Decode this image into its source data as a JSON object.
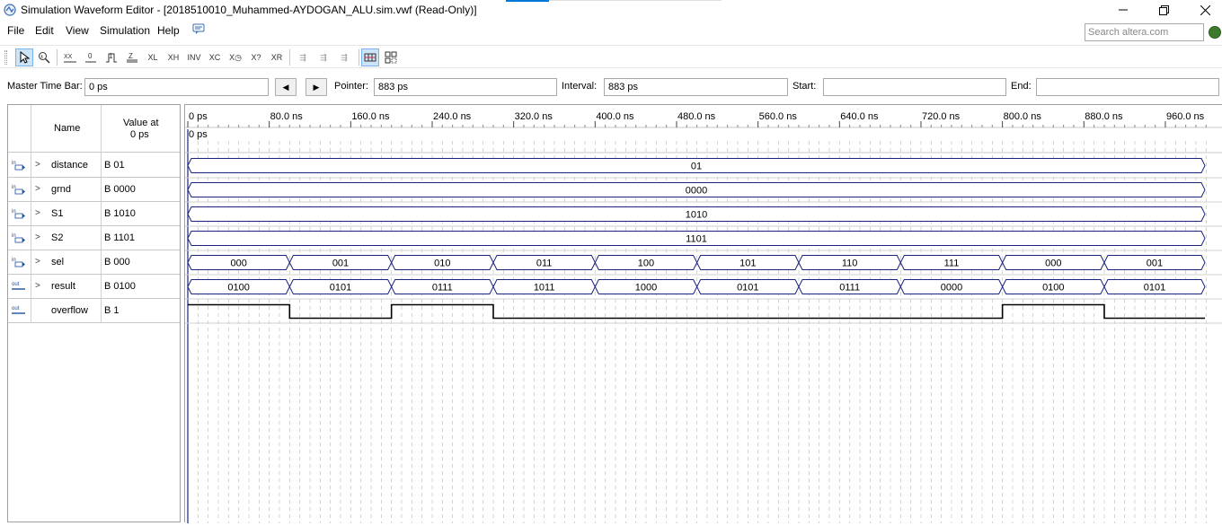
{
  "window": {
    "title": "Simulation Waveform Editor - [2018510010_Muhammed-AYDOGAN_ALU.sim.vwf (Read-Only)]"
  },
  "menu": [
    "File",
    "Edit",
    "View",
    "Simulation",
    "Help"
  ],
  "search": {
    "placeholder": "Search altera.com"
  },
  "timebar": {
    "master_label": "Master Time Bar:",
    "master_value": "0 ps",
    "pointer_label": "Pointer:",
    "pointer_value": "883 ps",
    "interval_label": "Interval:",
    "interval_value": "883 ps",
    "start_label": "Start:",
    "start_value": "",
    "end_label": "End:",
    "end_value": ""
  },
  "columns": {
    "name": "Name",
    "value_line1": "Value at",
    "value_line2": "0 ps"
  },
  "signals": [
    {
      "name": "distance",
      "value": "B 01",
      "dir": "in",
      "bus": true
    },
    {
      "name": "grnd",
      "value": "B 0000",
      "dir": "in",
      "bus": true
    },
    {
      "name": "S1",
      "value": "B 1010",
      "dir": "in",
      "bus": true
    },
    {
      "name": "S2",
      "value": "B 1101",
      "dir": "in",
      "bus": true
    },
    {
      "name": "sel",
      "value": "B 000",
      "dir": "in",
      "bus": true
    },
    {
      "name": "result",
      "value": "B 0100",
      "dir": "out",
      "bus": true
    },
    {
      "name": "overflow",
      "value": "B 1",
      "dir": "out",
      "bus": false
    }
  ],
  "time_axis": {
    "tick_labels": [
      "0 ps",
      "80.0 ns",
      "160.0 ns",
      "240.0 ns",
      "320.0 ns",
      "400.0 ns",
      "480.0 ns",
      "560.0 ns",
      "640.0 ns",
      "720.0 ns",
      "800.0 ns",
      "880.0 ns",
      "960.0 ns"
    ],
    "cursor_label": "0 ps"
  },
  "waves": {
    "distance": [
      {
        "start": 0,
        "end": 1000,
        "value": "01"
      }
    ],
    "grnd": [
      {
        "start": 0,
        "end": 1000,
        "value": "0000"
      }
    ],
    "S1": [
      {
        "start": 0,
        "end": 1000,
        "value": "1010"
      }
    ],
    "S2": [
      {
        "start": 0,
        "end": 1000,
        "value": "1101"
      }
    ],
    "sel": [
      {
        "start": 0,
        "end": 100,
        "value": "000"
      },
      {
        "start": 100,
        "end": 200,
        "value": "001"
      },
      {
        "start": 200,
        "end": 300,
        "value": "010"
      },
      {
        "start": 300,
        "end": 400,
        "value": "011"
      },
      {
        "start": 400,
        "end": 500,
        "value": "100"
      },
      {
        "start": 500,
        "end": 600,
        "value": "101"
      },
      {
        "start": 600,
        "end": 700,
        "value": "110"
      },
      {
        "start": 700,
        "end": 800,
        "value": "111"
      },
      {
        "start": 800,
        "end": 900,
        "value": "000"
      },
      {
        "start": 900,
        "end": 1000,
        "value": "001"
      }
    ],
    "result": [
      {
        "start": 0,
        "end": 100,
        "value": "0100"
      },
      {
        "start": 100,
        "end": 200,
        "value": "0101"
      },
      {
        "start": 200,
        "end": 300,
        "value": "0111"
      },
      {
        "start": 300,
        "end": 400,
        "value": "1011"
      },
      {
        "start": 400,
        "end": 500,
        "value": "1000"
      },
      {
        "start": 500,
        "end": 600,
        "value": "0101"
      },
      {
        "start": 600,
        "end": 700,
        "value": "0111"
      },
      {
        "start": 700,
        "end": 800,
        "value": "0000"
      },
      {
        "start": 800,
        "end": 900,
        "value": "0100"
      },
      {
        "start": 900,
        "end": 1000,
        "value": "0101"
      }
    ],
    "overflow": [
      {
        "start": 0,
        "end": 100,
        "level": 1
      },
      {
        "start": 100,
        "end": 200,
        "level": 0
      },
      {
        "start": 200,
        "end": 300,
        "level": 1
      },
      {
        "start": 300,
        "end": 800,
        "level": 0
      },
      {
        "start": 800,
        "end": 900,
        "level": 1
      },
      {
        "start": 900,
        "end": 1000,
        "level": 0
      }
    ]
  },
  "colors": {
    "wave": "#1a237e",
    "grid": "#b8b8b8",
    "cursor": "#1a237e"
  }
}
